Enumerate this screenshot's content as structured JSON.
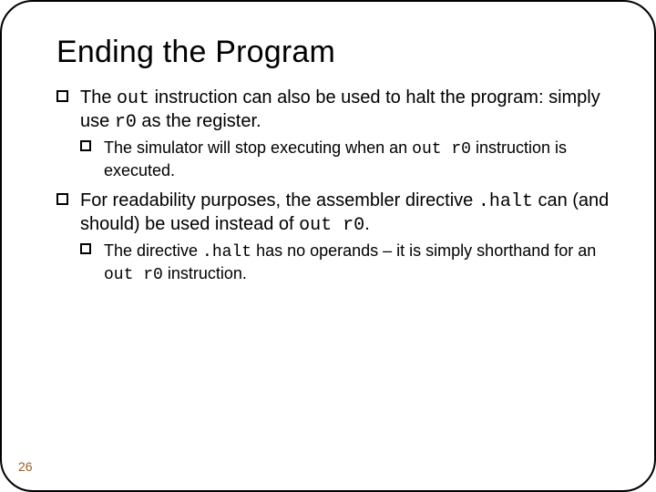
{
  "title": "Ending the Program",
  "bullets": {
    "b1": {
      "pre": "The ",
      "code1": "out",
      "mid": " instruction can also be used to halt the program: simply use ",
      "code2": "r0",
      "post": " as the register."
    },
    "b1a": {
      "pre": "The simulator will stop executing when an ",
      "code1": "out r0",
      "post": " instruction is executed."
    },
    "b2": {
      "pre": "For readability purposes, the assembler directive ",
      "code1": ".halt",
      "mid": " can (and should) be used instead of ",
      "code2": "out r0",
      "post": "."
    },
    "b2a": {
      "pre": "The directive ",
      "code1": ".halt",
      "mid": " has no operands – it is simply shorthand for an ",
      "code2": "out r0",
      "post": " instruction."
    }
  },
  "page_number": "26"
}
